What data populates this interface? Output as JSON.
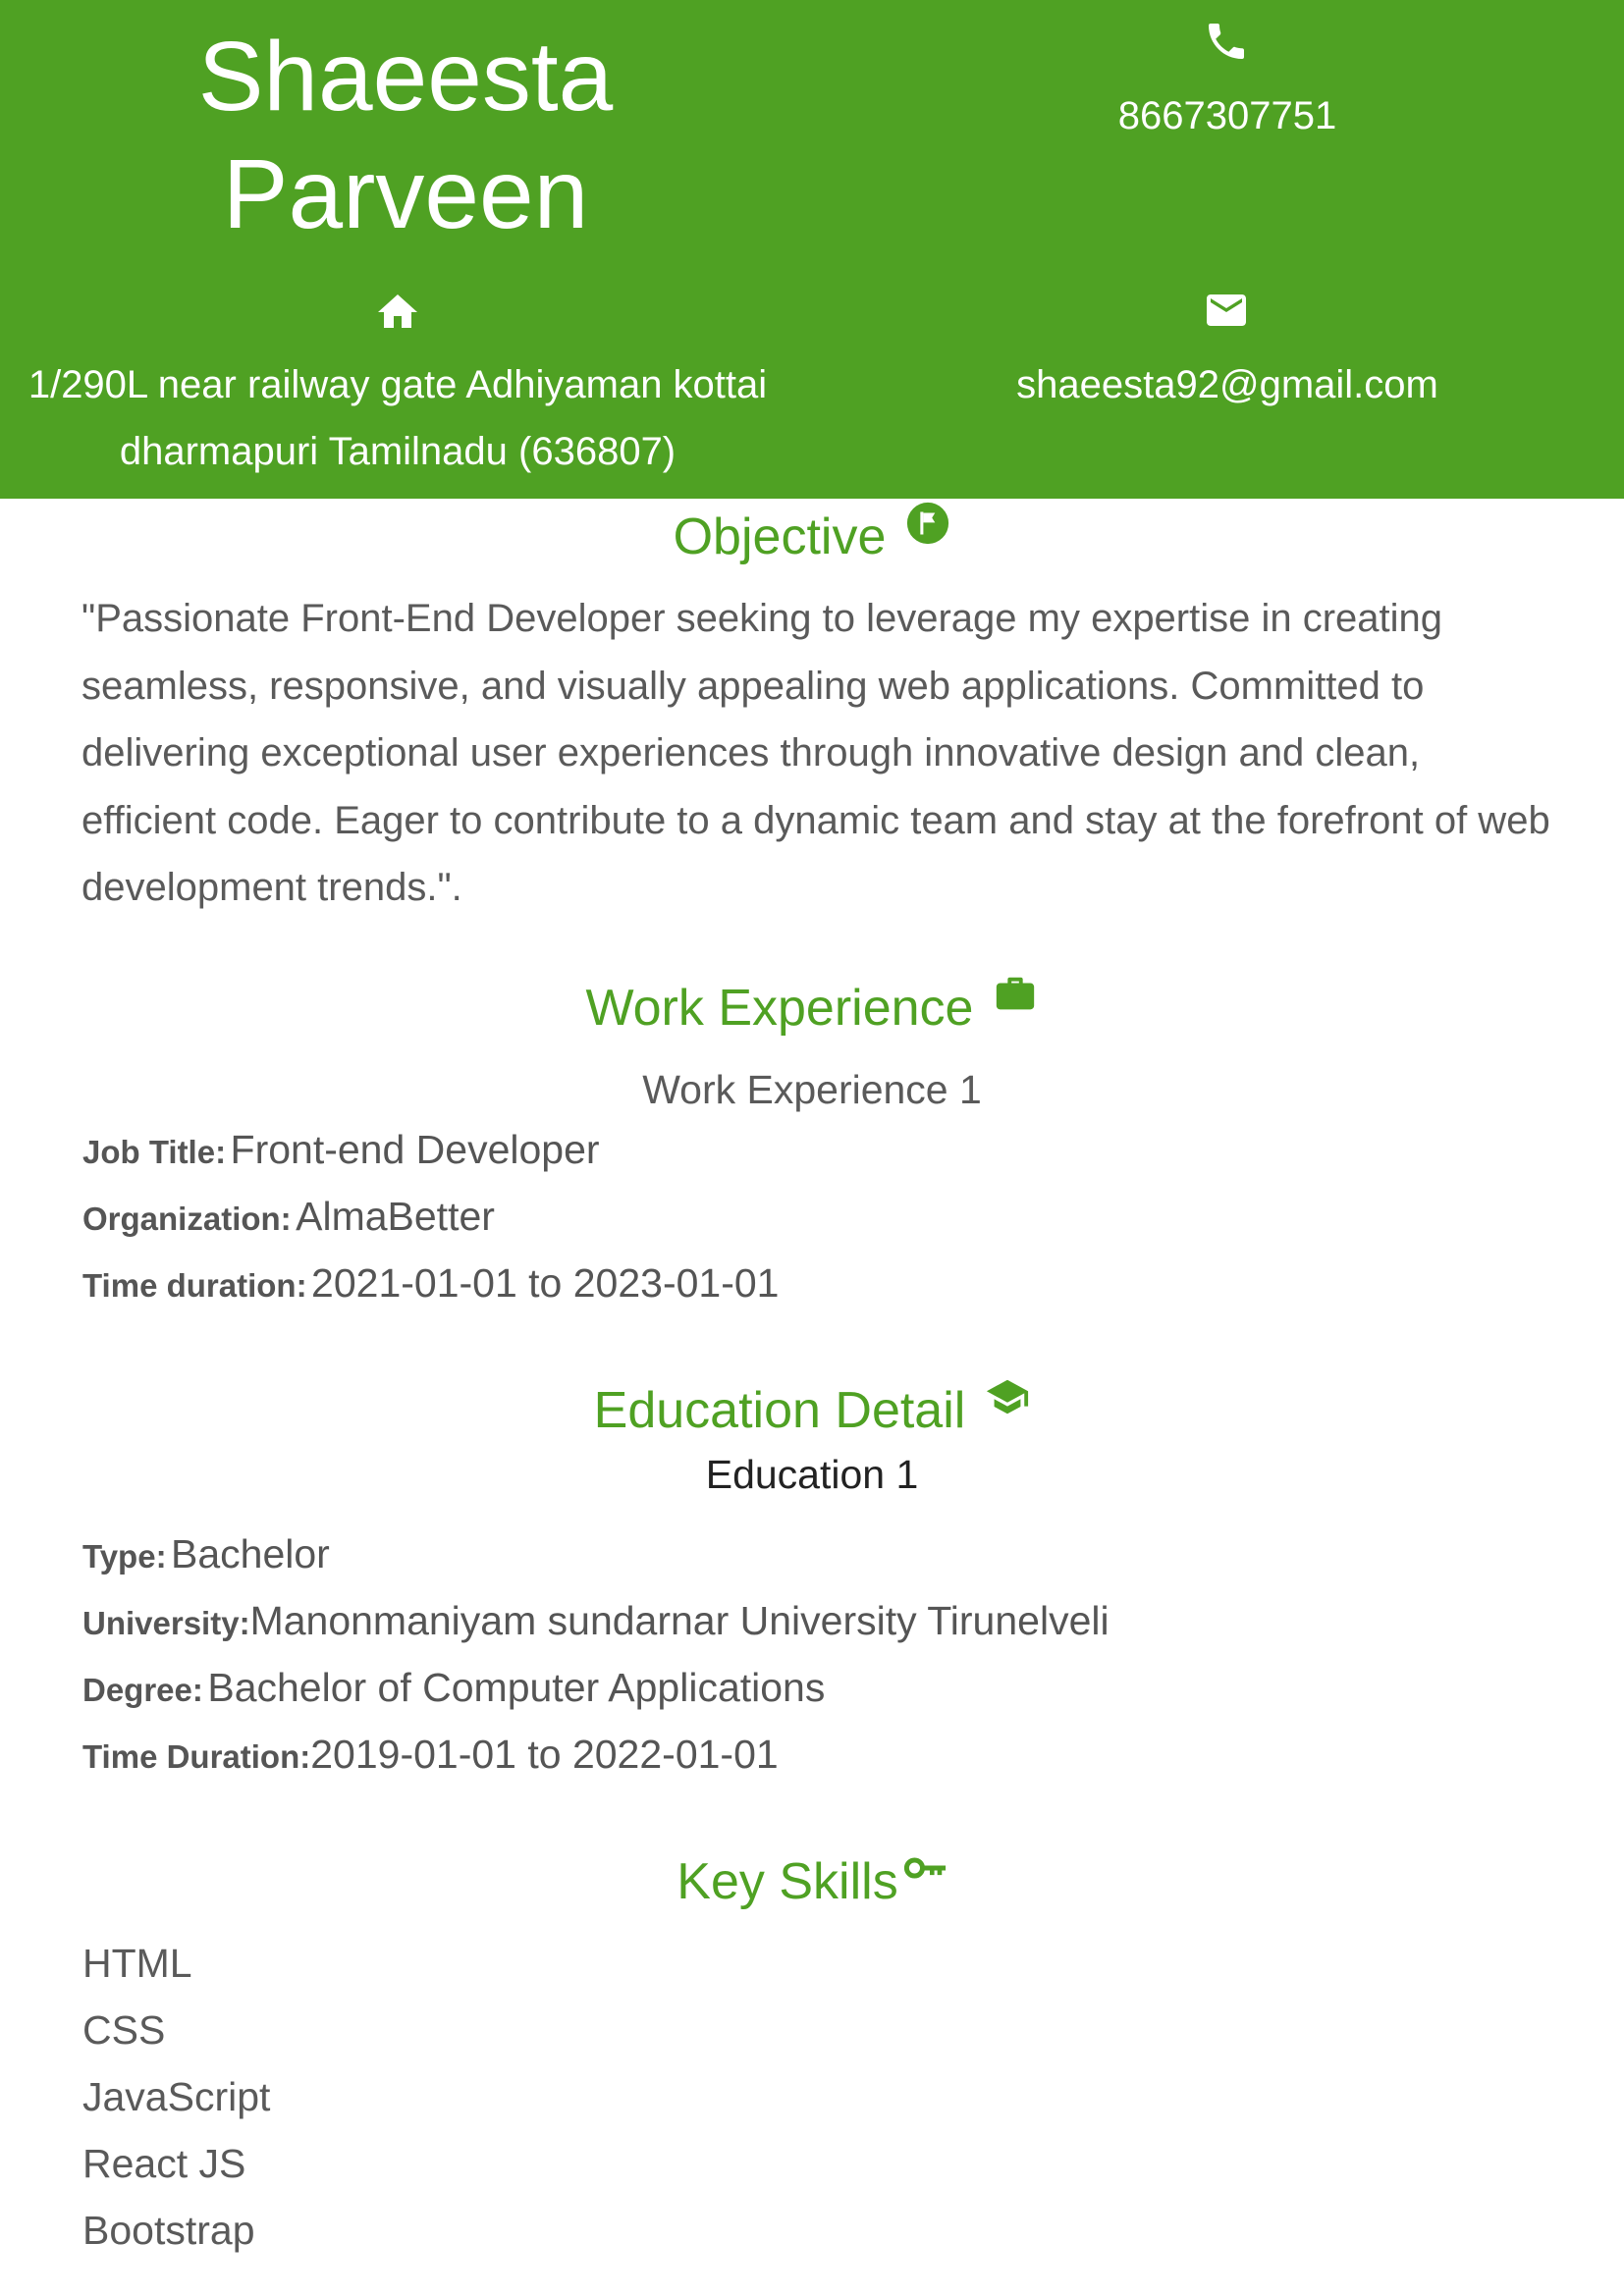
{
  "header": {
    "first_name": "Shaeesta",
    "last_name": "Parveen",
    "phone": "8667307751",
    "address_line1": "1/290L near railway gate Adhiyaman kottai",
    "address_line2": "dharmapuri Tamilnadu (636807)",
    "email": "shaeesta92@gmail.com",
    "background_color": "#4fa123"
  },
  "objective": {
    "title": "Objective",
    "icon": "flag-circle-icon",
    "text": "\"Passionate Front-End Developer seeking to leverage my expertise in creating seamless, responsive, and visually appealing web applications. Committed to delivering exceptional user experiences through innovative design and clean, efficient code. Eager to contribute to a dynamic team and stay at the forefront of web development trends.\"."
  },
  "work": {
    "title": "Work Experience",
    "icon": "briefcase-icon",
    "items": [
      {
        "heading": "Work Experience 1",
        "job_title_label": "Job Title:",
        "job_title": "Front-end Developer",
        "organization_label": "Organization:",
        "organization": "AlmaBetter",
        "duration_label": "Time duration:",
        "duration": "2021-01-01 to 2023-01-01"
      }
    ]
  },
  "education": {
    "title": "Education Detail",
    "icon": "graduation-cap-icon",
    "items": [
      {
        "heading": "Education 1",
        "type_label": "Type:",
        "type": "Bachelor",
        "university_label": "University:",
        "university": "Manonmaniyam sundarnar University Tirunelveli",
        "degree_label": "Degree:",
        "degree": "Bachelor of Computer Applications",
        "duration_label": "Time Duration:",
        "duration": "2019-01-01 to 2022-01-01"
      }
    ]
  },
  "skills": {
    "title": "Key Skills",
    "icon": "key-icon",
    "items": [
      "HTML",
      "CSS",
      "JavaScript",
      "React JS",
      "Bootstrap"
    ]
  },
  "colors": {
    "accent": "#4fa123",
    "body_text": "#5a5a5a",
    "dark_text": "#222222"
  }
}
